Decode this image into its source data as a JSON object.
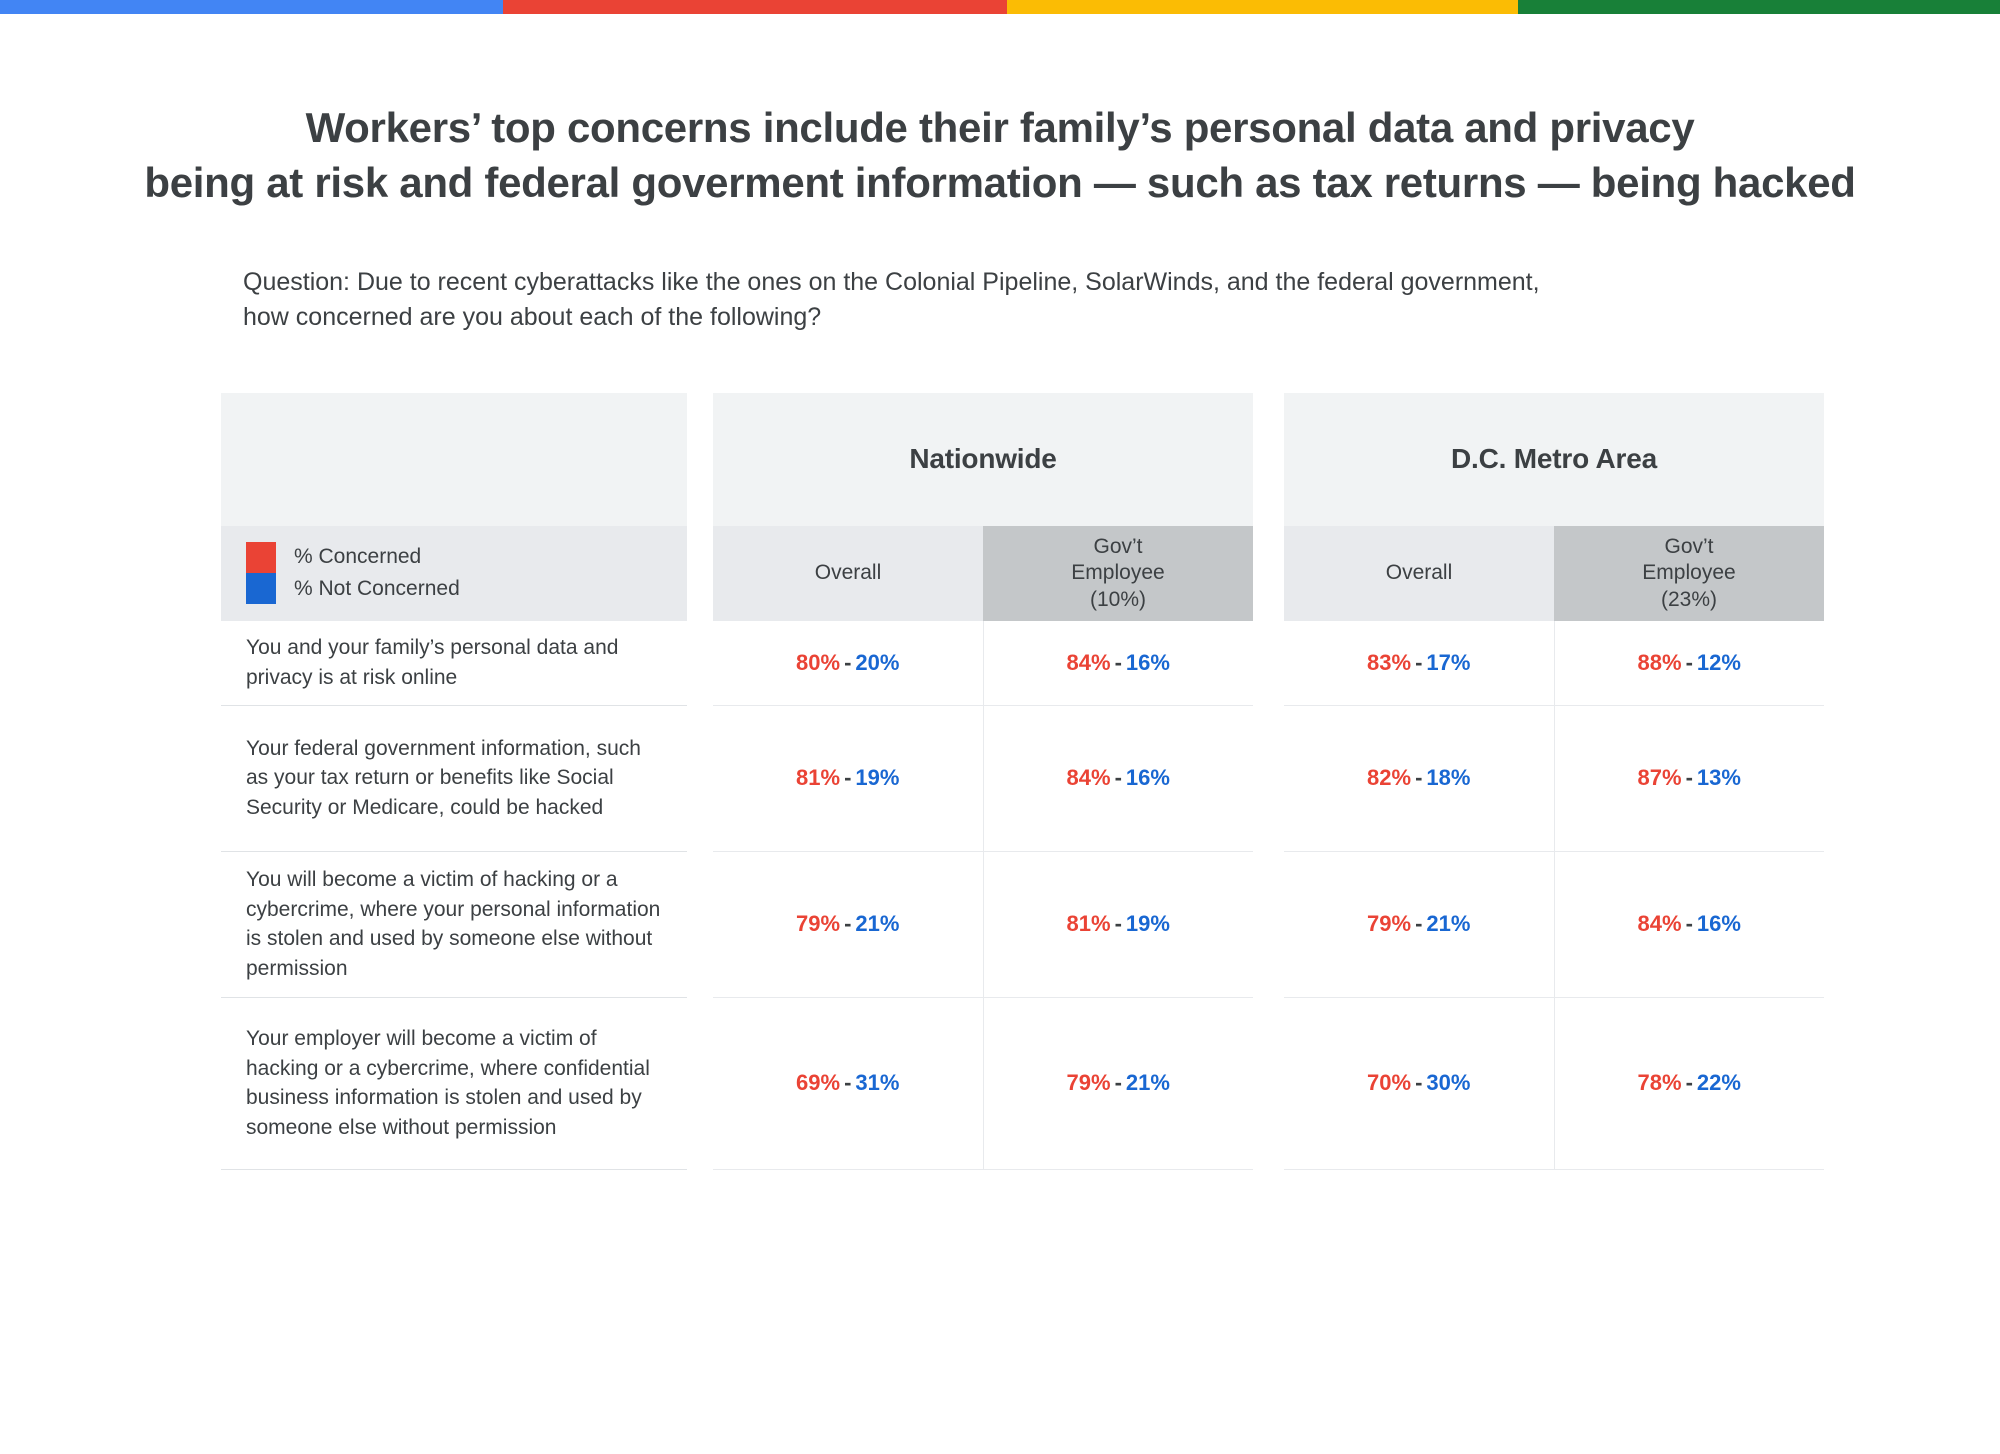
{
  "topbar": {
    "segments": [
      {
        "name": "blue",
        "color": "#4285F4"
      },
      {
        "name": "red",
        "color": "#EA4335"
      },
      {
        "name": "yellow",
        "color": "#FBBC04"
      },
      {
        "name": "green",
        "color": "#188038"
      }
    ]
  },
  "headline": {
    "line1": "Workers’ top concerns include their family’s personal data and privacy",
    "line2": "being at risk and federal goverment information — such as tax returns —  being hacked"
  },
  "question": {
    "line1": "Question: Due to recent cyberattacks like the ones on the Colonial Pipeline, SolarWinds, and the federal government,",
    "line2": "how concerned are you about each of the following?"
  },
  "legend": {
    "concerned_label": "% Concerned",
    "not_concerned_label": "% Not Concerned",
    "concerned_color": "#EA4335",
    "not_concerned_color": "#1967D2"
  },
  "groups": [
    {
      "title": "Nationwide",
      "columns": [
        {
          "label": "Overall",
          "label_line2": "",
          "label_line3": "",
          "emphasis": false
        },
        {
          "label": "Gov’t",
          "label_line2": "Employee",
          "label_line3": "(10%)",
          "emphasis": true
        }
      ]
    },
    {
      "title": "D.C. Metro Area",
      "columns": [
        {
          "label": "Overall",
          "label_line2": "",
          "label_line3": "",
          "emphasis": false
        },
        {
          "label": "Gov’t",
          "label_line2": "Employee",
          "label_line3": "(23%)",
          "emphasis": true
        }
      ]
    }
  ],
  "rows": [
    {
      "label": "You and your family’s personal data and privacy is at risk online",
      "values": {
        "nationwide_overall": {
          "concerned": "80%",
          "not_concerned": "20%"
        },
        "nationwide_gov": {
          "concerned": "84%",
          "not_concerned": "16%"
        },
        "dc_overall": {
          "concerned": "83%",
          "not_concerned": "17%"
        },
        "dc_gov": {
          "concerned": "88%",
          "not_concerned": "12%"
        }
      }
    },
    {
      "label": "Your federal government information, such as your tax return or benefits like Social Security or Medicare, could be hacked",
      "values": {
        "nationwide_overall": {
          "concerned": "81%",
          "not_concerned": "19%"
        },
        "nationwide_gov": {
          "concerned": "84%",
          "not_concerned": "16%"
        },
        "dc_overall": {
          "concerned": "82%",
          "not_concerned": "18%"
        },
        "dc_gov": {
          "concerned": "87%",
          "not_concerned": "13%"
        }
      }
    },
    {
      "label": "You will become a victim of hacking or a cybercrime, where your personal information is stolen and used by someone else without permission",
      "values": {
        "nationwide_overall": {
          "concerned": "79%",
          "not_concerned": "21%"
        },
        "nationwide_gov": {
          "concerned": "81%",
          "not_concerned": "19%"
        },
        "dc_overall": {
          "concerned": "79%",
          "not_concerned": "21%"
        },
        "dc_gov": {
          "concerned": "84%",
          "not_concerned": "16%"
        }
      }
    },
    {
      "label": "Your employer will become a victim of hacking or a cybercrime, where confidential business information is stolen and used by someone else without permission",
      "values": {
        "nationwide_overall": {
          "concerned": "69%",
          "not_concerned": "31%"
        },
        "nationwide_gov": {
          "concerned": "79%",
          "not_concerned": "21%"
        },
        "dc_overall": {
          "concerned": "70%",
          "not_concerned": "30%"
        },
        "dc_gov": {
          "concerned": "78%",
          "not_concerned": "22%"
        }
      }
    }
  ],
  "separator": "-",
  "chart_data": {
    "type": "table",
    "title": "Workers’ top concerns include their family’s personal data and privacy being at risk and federal goverment information — such as tax returns —  being hacked",
    "subtitle": "Question: Due to recent cyberattacks like the ones on the Colonial Pipeline, SolarWinds, and the federal government, how concerned are you about each of the following?",
    "legend": [
      "% Concerned",
      "% Not Concerned"
    ],
    "column_groups": [
      "Nationwide",
      "D.C. Metro Area"
    ],
    "columns": [
      "Overall",
      "Gov’t Employee (10%)",
      "Overall",
      "Gov’t Employee (23%)"
    ],
    "categories": [
      "You and your family’s personal data and privacy is at risk online",
      "Your federal government information, such as your tax return or benefits like Social Security or Medicare, could be hacked",
      "You will become a victim of hacking or a cybercrime, where your personal information is stolen and used by someone else without permission",
      "Your employer will become a victim of hacking or a cybercrime, where confidential business information is stolen and used by someone else without permission"
    ],
    "series": [
      {
        "name": "Nationwide Overall — % Concerned",
        "values": [
          80,
          81,
          79,
          69
        ]
      },
      {
        "name": "Nationwide Overall — % Not Concerned",
        "values": [
          20,
          19,
          21,
          31
        ]
      },
      {
        "name": "Nationwide Gov’t Employee — % Concerned",
        "values": [
          84,
          84,
          81,
          79
        ]
      },
      {
        "name": "Nationwide Gov’t Employee — % Not Concerned",
        "values": [
          16,
          16,
          19,
          21
        ]
      },
      {
        "name": "D.C. Metro Overall — % Concerned",
        "values": [
          83,
          82,
          79,
          70
        ]
      },
      {
        "name": "D.C. Metro Overall — % Not Concerned",
        "values": [
          17,
          18,
          21,
          30
        ]
      },
      {
        "name": "D.C. Metro Gov’t Employee — % Concerned",
        "values": [
          88,
          87,
          84,
          78
        ]
      },
      {
        "name": "D.C. Metro Gov’t Employee — % Not Concerned",
        "values": [
          12,
          13,
          16,
          22
        ]
      }
    ],
    "units": "percent",
    "colors": {
      "concerned": "#EA4335",
      "not_concerned": "#1967D2"
    }
  }
}
